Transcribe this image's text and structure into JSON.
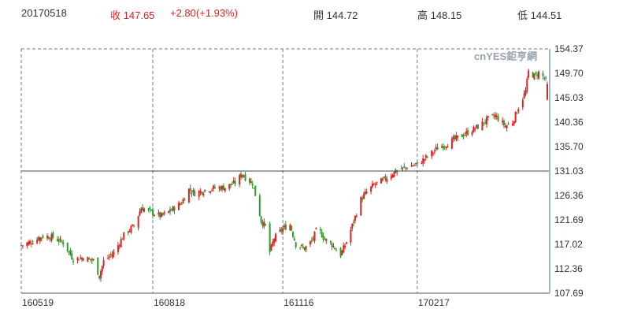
{
  "header": {
    "date": "20170518",
    "close_label": "收",
    "close": "147.65",
    "change": "+2.80(+1.93%)",
    "open_label": "開",
    "open": "144.72",
    "high_label": "高",
    "high": "148.15",
    "low_label": "低",
    "low": "144.51"
  },
  "watermark": "cnYES鉅亨網",
  "colors": {
    "up": "#dd2222",
    "down": "#2a9d2a",
    "grid": "#777777",
    "reference": "#444444",
    "axis_bar": "#9ab8d8"
  },
  "chart_data": {
    "type": "candlestick",
    "title": "",
    "xlabel": "",
    "ylabel": "",
    "ylim": [
      107.69,
      154.37
    ],
    "y_ticks": [
      154.37,
      149.7,
      145.03,
      140.36,
      135.7,
      131.03,
      126.36,
      121.69,
      117.02,
      112.36,
      107.69
    ],
    "y_tick_labels": [
      "154.37",
      "149.70",
      "145.03",
      "140.36",
      "135.70",
      "131.03",
      "126.36",
      "121.69",
      "117.02",
      "112.36",
      "107.69"
    ],
    "x_range": [
      "2016-05-19",
      "2017-05-18"
    ],
    "x_ticks": [
      {
        "date": "2016-05-19",
        "label": "160519"
      },
      {
        "date": "2016-08-18",
        "label": "160818"
      },
      {
        "date": "2016-11-16",
        "label": "161116"
      },
      {
        "date": "2017-02-17",
        "label": "170217"
      }
    ],
    "reference_line": 131.03,
    "grid": "vertical dashed at x-ticks",
    "close_path": [
      [
        "2016-05-19",
        116.8
      ],
      [
        "2016-05-26",
        117.5
      ],
      [
        "2016-06-03",
        118.6
      ],
      [
        "2016-06-10",
        118.4
      ],
      [
        "2016-06-17",
        117.3
      ],
      [
        "2016-06-24",
        114.2
      ],
      [
        "2016-07-01",
        114.5
      ],
      [
        "2016-07-08",
        113.9
      ],
      [
        "2016-07-12",
        111.0
      ],
      [
        "2016-07-15",
        113.8
      ],
      [
        "2016-07-22",
        115.4
      ],
      [
        "2016-07-29",
        118.8
      ],
      [
        "2016-08-05",
        120.6
      ],
      [
        "2016-08-10",
        124.0
      ],
      [
        "2016-08-12",
        123.8
      ],
      [
        "2016-08-18",
        123.0
      ],
      [
        "2016-08-24",
        122.4
      ],
      [
        "2016-08-31",
        123.6
      ],
      [
        "2016-09-07",
        125.0
      ],
      [
        "2016-09-12",
        127.5
      ],
      [
        "2016-09-16",
        126.8
      ],
      [
        "2016-09-23",
        127.4
      ],
      [
        "2016-09-30",
        127.8
      ],
      [
        "2016-10-07",
        127.9
      ],
      [
        "2016-10-14",
        128.8
      ],
      [
        "2016-10-19",
        130.5
      ],
      [
        "2016-10-21",
        129.8
      ],
      [
        "2016-10-26",
        128.7
      ],
      [
        "2016-10-28",
        126.5
      ],
      [
        "2016-11-01",
        121.5
      ],
      [
        "2016-11-04",
        120.5
      ],
      [
        "2016-11-07",
        115.5
      ],
      [
        "2016-11-10",
        118.2
      ],
      [
        "2016-11-16",
        120.0
      ],
      [
        "2016-11-21",
        120.8
      ],
      [
        "2016-11-25",
        117.0
      ],
      [
        "2016-12-01",
        116.2
      ],
      [
        "2016-12-06",
        117.6
      ],
      [
        "2016-12-10",
        120.2
      ],
      [
        "2016-12-15",
        118.0
      ],
      [
        "2016-12-20",
        117.0
      ],
      [
        "2016-12-26",
        115.0
      ],
      [
        "2016-12-30",
        117.5
      ],
      [
        "2017-01-04",
        121.4
      ],
      [
        "2017-01-09",
        125.6
      ],
      [
        "2017-01-13",
        127.0
      ],
      [
        "2017-01-18",
        128.4
      ],
      [
        "2017-01-24",
        129.2
      ],
      [
        "2017-01-30",
        130.4
      ],
      [
        "2017-02-03",
        131.1
      ],
      [
        "2017-02-10",
        131.8
      ],
      [
        "2017-02-17",
        132.3
      ],
      [
        "2017-02-24",
        133.8
      ],
      [
        "2017-03-03",
        135.4
      ],
      [
        "2017-03-10",
        136.3
      ],
      [
        "2017-03-17",
        137.4
      ],
      [
        "2017-03-24",
        138.4
      ],
      [
        "2017-03-31",
        139.5
      ],
      [
        "2017-04-07",
        141.0
      ],
      [
        "2017-04-12",
        141.6
      ],
      [
        "2017-04-19",
        139.6
      ],
      [
        "2017-04-24",
        140.4
      ],
      [
        "2017-04-28",
        143.2
      ],
      [
        "2017-05-03",
        146.2
      ],
      [
        "2017-05-05",
        150.0
      ],
      [
        "2017-05-09",
        149.2
      ],
      [
        "2017-05-12",
        149.8
      ],
      [
        "2017-05-16",
        148.8
      ],
      [
        "2017-05-18",
        147.65
      ]
    ],
    "last_candle": {
      "date": "2017-05-18",
      "open": 144.72,
      "high": 148.15,
      "low": 144.51,
      "close": 147.65
    }
  }
}
